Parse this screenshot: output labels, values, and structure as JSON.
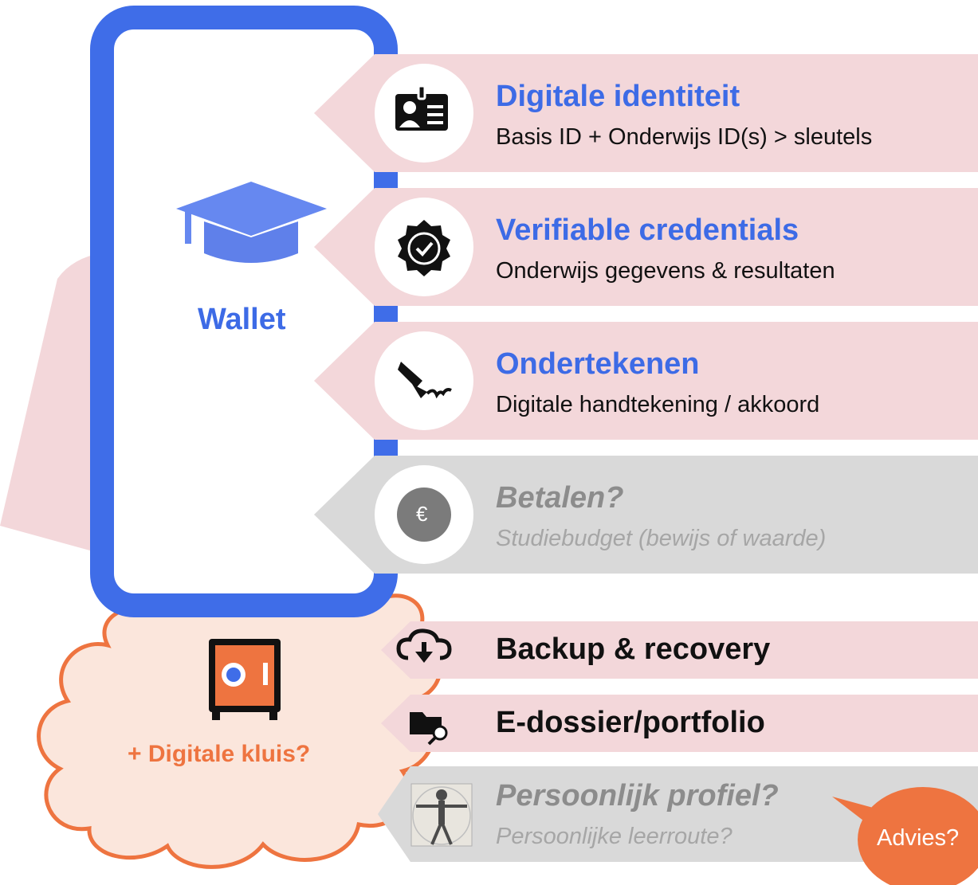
{
  "wallet": {
    "label": "Wallet",
    "icon": "graduation-cap-icon",
    "frame_color": "#3f6de8"
  },
  "features": [
    {
      "title": "Digitale identiteit",
      "subtitle": "Basis ID + Onderwijs ID(s) > sleutels",
      "icon": "id-badge-icon",
      "active": true
    },
    {
      "title": "Verifiable credentials",
      "subtitle": "Onderwijs gegevens & resultaten",
      "icon": "verified-badge-icon",
      "active": true
    },
    {
      "title": "Ondertekenen",
      "subtitle": "Digitale handtekening / akkoord",
      "icon": "pen-signature-icon",
      "active": true
    },
    {
      "title": "Betalen?",
      "subtitle": "Studiebudget (bewijs of waarde)",
      "icon": "euro-icon",
      "active": false
    }
  ],
  "vault": {
    "label": "+ Digitale kluis?",
    "icon": "safe-icon",
    "color": "#ee7440",
    "items": [
      {
        "title": "Backup & recovery",
        "icon": "cloud-download-icon",
        "active": true
      },
      {
        "title": "E-dossier/portfolio",
        "icon": "folder-search-icon",
        "active": true
      }
    ]
  },
  "profile": {
    "title": "Persoonlijk profiel?",
    "subtitle": "Persoonlijke leerroute?",
    "icon": "vitruvian-man-icon",
    "active": false
  },
  "advice_bubble": {
    "label": "Advies?",
    "color": "#ee7440"
  }
}
